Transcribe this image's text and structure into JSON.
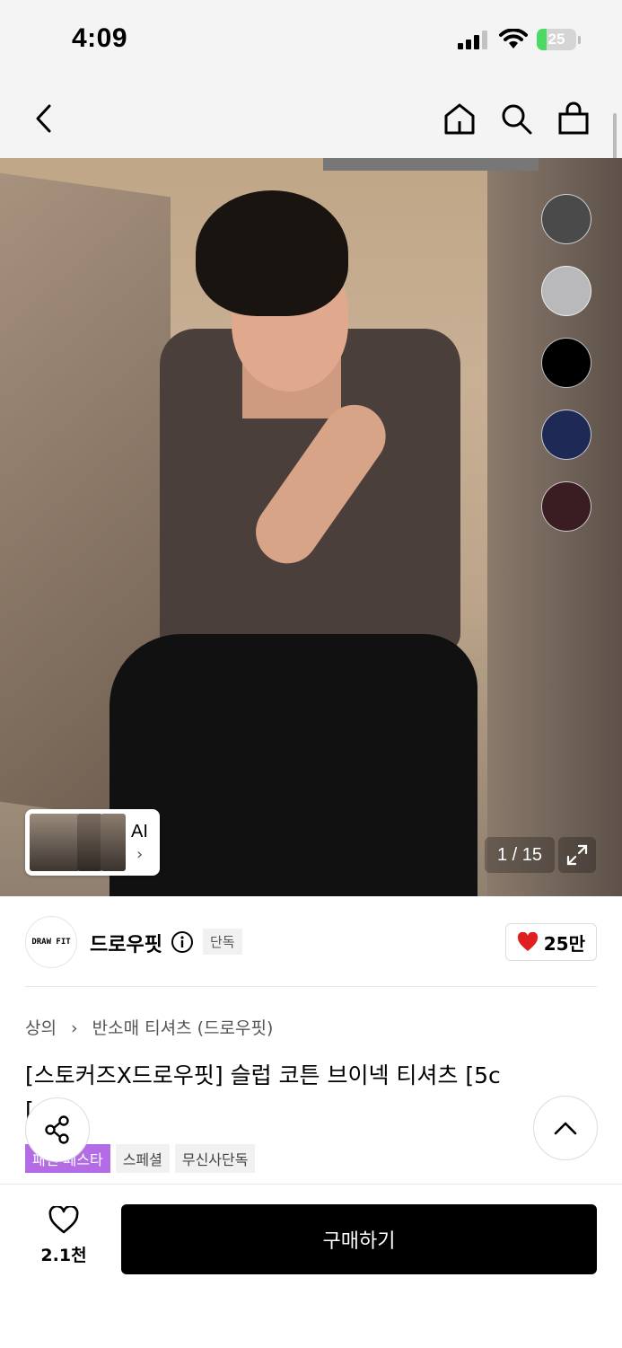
{
  "status_bar": {
    "time": "4:09",
    "battery": "25",
    "battery_level": 0.25
  },
  "nav": {
    "back_icon": "chevron-left-icon",
    "home_icon": "home-icon",
    "search_icon": "search-icon",
    "bag_icon": "shopping-bag-icon"
  },
  "gallery": {
    "swatch_colors": [
      "#4a4a4a",
      "#b9b9bc",
      "#000000",
      "#1e2a55",
      "#3a1d22"
    ],
    "ai_label": "AI",
    "page_counter": "1 / 15",
    "expand_icon": "expand-icon"
  },
  "brand": {
    "logo_text": "DRAW FIT",
    "name": "드로우핏",
    "badge": "단독",
    "like_count": "25만",
    "like_color": "#e02020"
  },
  "breadcrumb": {
    "category": "상의",
    "subcategory": "반소매 티셔츠 (드로우핏)"
  },
  "product": {
    "title": "[스토커즈X드로우핏] 슬럽 코튼 브이넥 티셔츠 [5c",
    "title_line2": "[...]",
    "tags": [
      "패션 페스타",
      "스페셜",
      "무신사단독"
    ]
  },
  "bottom": {
    "wish_count": "2.1천",
    "buy_label": "구매하기"
  }
}
